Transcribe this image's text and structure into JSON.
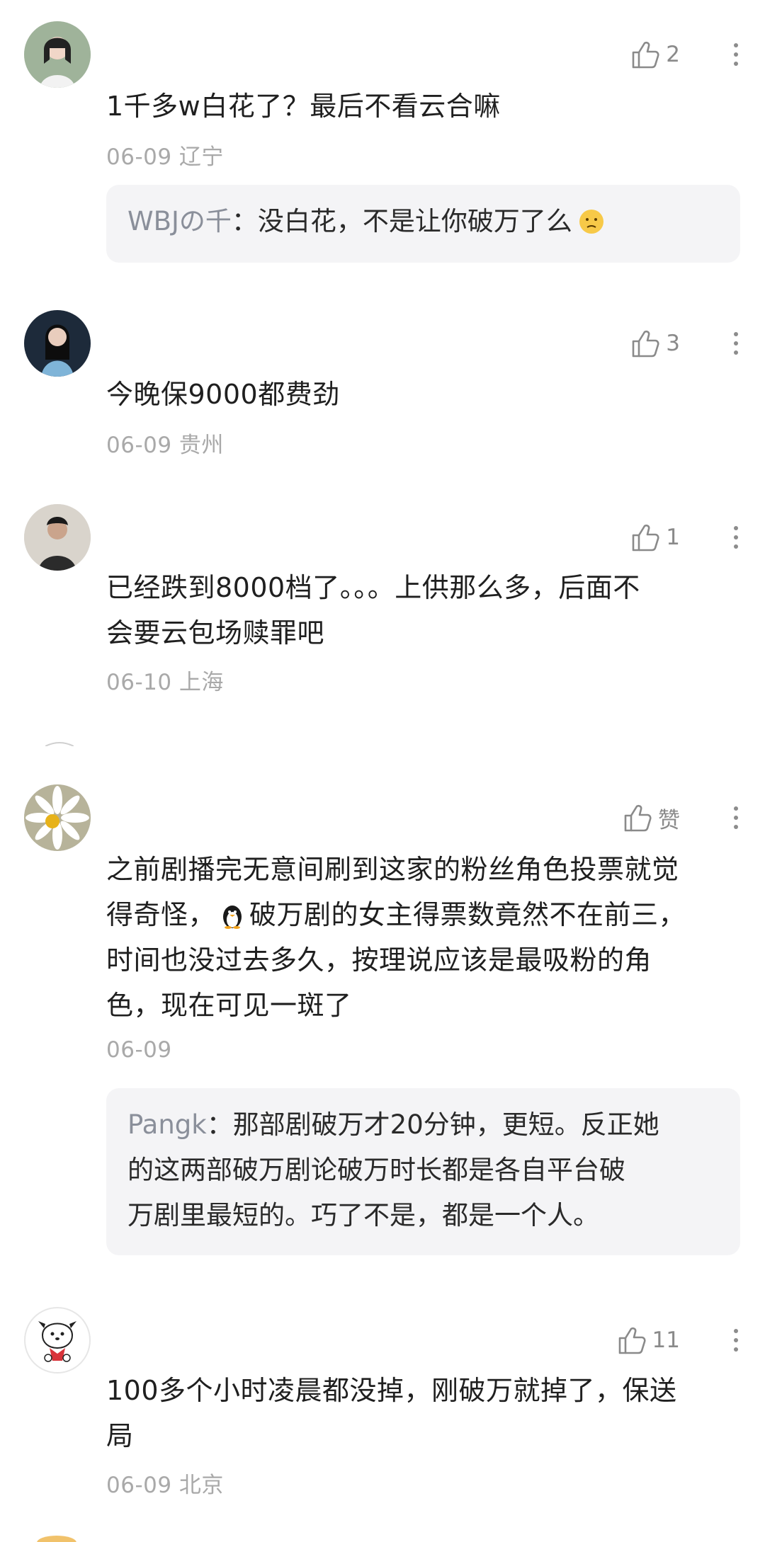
{
  "comments": [
    {
      "likes": "2",
      "text": "1千多w白花了？最后不看云合嘛",
      "meta": "06-09 辽宁",
      "reply": {
        "name": "WBJの千",
        "sep": "：",
        "text": "没白花，不是让你破万了么"
      }
    },
    {
      "likes": "3",
      "text": "今晚保9000都费劲",
      "meta": "06-09 贵州"
    },
    {
      "likes": "1",
      "text_lines": [
        "已经跌到8000档了。。。上供那么多，后面不",
        "会要云包场赎罪吧"
      ],
      "meta": "06-10 上海"
    },
    {
      "likes": "赞",
      "text_lines": [
        "之前剧播完无意间刷到这家的粉丝角色投票就觉",
        "得奇怪，",
        "破万剧的女主得票数竟然不在前三，",
        "时间也没过去多久，按理说应该是最吸粉的角",
        "色，现在可见一斑了"
      ],
      "meta": "06-09",
      "reply": {
        "name": "Pangk",
        "sep": "：",
        "text_lines": [
          "那部剧破万才20分钟，更短。反正她",
          "的这两部破万剧论破万时长都是各自平台破",
          "万剧里最短的。巧了不是，都是一个人。"
        ]
      }
    },
    {
      "likes": "11",
      "text_lines": [
        "100多个小时凌晨都没掉，刚破万就掉了，保送",
        "局"
      ],
      "meta": "06-09 北京"
    }
  ],
  "icons": {
    "like": "thumbs-up-icon",
    "more": "more-vertical-icon",
    "emoji": "face-emoji-icon",
    "penguin": "penguin-emoji-icon"
  },
  "colors": {
    "text": "#1f1f1f",
    "meta": "#a9a9a9",
    "reply_bg": "#f4f4f6",
    "reply_name": "#8a8f9a",
    "icon": "#8a8a8a"
  }
}
